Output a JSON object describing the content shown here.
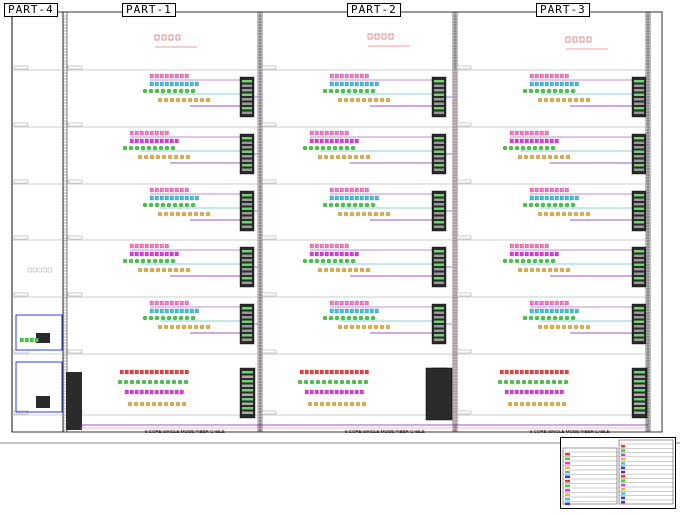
{
  "parts": [
    {
      "id": "part4",
      "label": "PART-4"
    },
    {
      "id": "part1",
      "label": "PART-1"
    },
    {
      "id": "part2",
      "label": "PART-2"
    },
    {
      "id": "part3",
      "label": "PART-3"
    }
  ],
  "fiber_cable_label": "6 CORE SINGLE MODE FIBER CABLE",
  "colors": {
    "rack": "#2b2b2b",
    "rack_port": "#6fd36f",
    "green_device": "#3fd13f",
    "cyan_device": "#39c6e6",
    "magenta_device": "#e23ae2",
    "orange_device": "#f2b13c",
    "red_line": "#e23a3a",
    "blue_line": "#2a3fe0",
    "purple_line": "#7a1fa2",
    "teal_line": "#1fa0a0",
    "pink_line": "#e86fb0",
    "grid_line": "#7a7a7a",
    "floor_line": "#9a9a9a"
  }
}
